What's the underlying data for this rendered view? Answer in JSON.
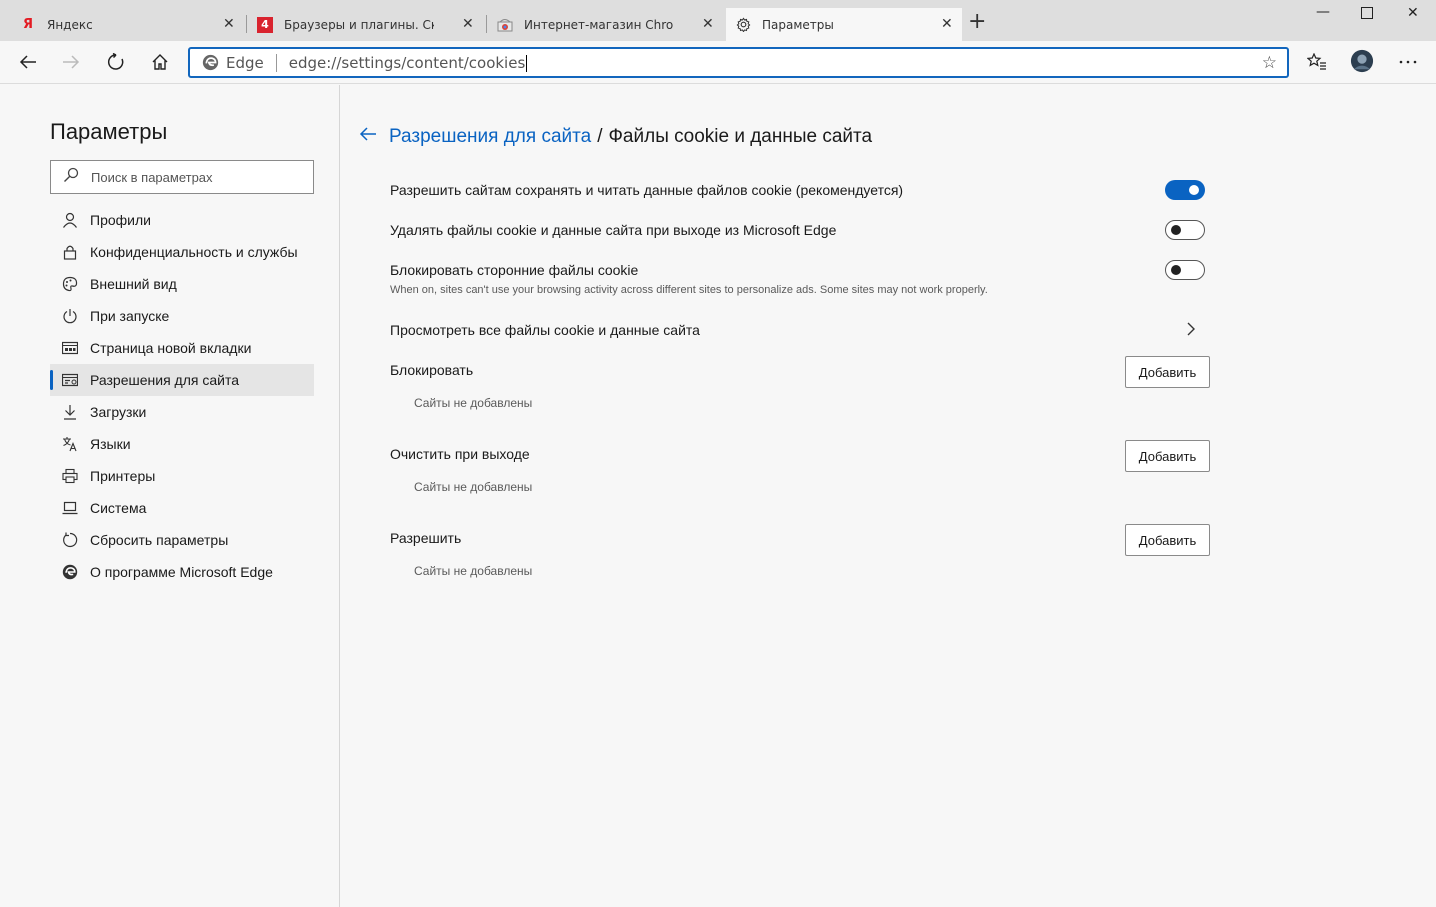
{
  "tabs": [
    {
      "title": "Яндекс",
      "favicon": "yandex-icon",
      "close": "✕"
    },
    {
      "title": "Браузеры и плагины. Скачать б",
      "favicon": "site-icon",
      "close": "✕"
    },
    {
      "title": "Интернет-магазин Chrome - Ра",
      "favicon": "chrome-store-icon",
      "close": "✕"
    },
    {
      "title": "Параметры",
      "favicon": "gear-icon",
      "close": "✕"
    }
  ],
  "toolbar": {
    "edge_label": "Edge",
    "url": "edge://settings/content/cookies"
  },
  "sidebar": {
    "title": "Параметры",
    "search_placeholder": "Поиск в параметрах",
    "items": [
      {
        "label": "Профили"
      },
      {
        "label": "Конфиденциальность и службы"
      },
      {
        "label": "Внешний вид"
      },
      {
        "label": "При запуске"
      },
      {
        "label": "Страница новой вкладки"
      },
      {
        "label": "Разрешения для сайта"
      },
      {
        "label": "Загрузки"
      },
      {
        "label": "Языки"
      },
      {
        "label": "Принтеры"
      },
      {
        "label": "Система"
      },
      {
        "label": "Сбросить параметры"
      },
      {
        "label": "О программе Microsoft Edge"
      }
    ]
  },
  "main": {
    "crumb_link": "Разрешения для сайта",
    "crumb_sep": "/",
    "crumb_current": "Файлы cookie и данные сайта",
    "settings": [
      {
        "label": "Разрешить сайтам сохранять и читать данные файлов cookie (рекомендуется)",
        "enabled": true
      },
      {
        "label": "Удалять файлы cookie и данные сайта при выходе из Microsoft Edge",
        "enabled": false
      },
      {
        "label": "Блокировать сторонние файлы cookie",
        "description": "When on, sites can't use your browsing activity across different sites to personalize ads. Some sites may not work properly.",
        "enabled": false
      }
    ],
    "view_all": "Просмотреть все файлы cookie и данные сайта",
    "lists": [
      {
        "label": "Блокировать",
        "button": "Добавить",
        "empty": "Сайты не добавлены"
      },
      {
        "label": "Очистить при выходе",
        "button": "Добавить",
        "empty": "Сайты не добавлены"
      },
      {
        "label": "Разрешить",
        "button": "Добавить",
        "empty": "Сайты не добавлены"
      }
    ]
  },
  "colors": {
    "accent": "#0a63c2",
    "yandex_red": "#e31b23"
  }
}
